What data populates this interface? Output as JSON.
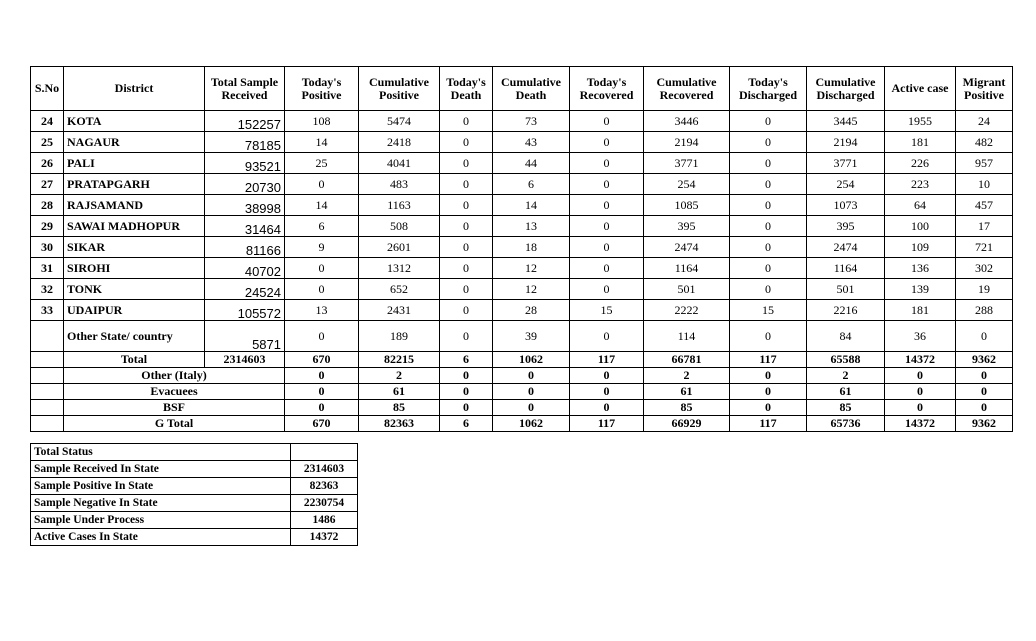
{
  "headers": [
    "S.No",
    "District",
    "Total Sample Received",
    "Today's Positive",
    "Cumulative Positive",
    "Today's Death",
    "Cumulative Death",
    "Today's Recovered",
    "Cumulative Recovered",
    "Today's Discharged",
    "Cumulative Discharged",
    "Active case",
    "Migrant Positive"
  ],
  "rows": [
    [
      "24",
      "KOTA",
      "152257",
      "108",
      "5474",
      "0",
      "73",
      "0",
      "3446",
      "0",
      "3445",
      "1955",
      "24"
    ],
    [
      "25",
      "NAGAUR",
      "78185",
      "14",
      "2418",
      "0",
      "43",
      "0",
      "2194",
      "0",
      "2194",
      "181",
      "482"
    ],
    [
      "26",
      "PALI",
      "93521",
      "25",
      "4041",
      "0",
      "44",
      "0",
      "3771",
      "0",
      "3771",
      "226",
      "957"
    ],
    [
      "27",
      "PRATAPGARH",
      "20730",
      "0",
      "483",
      "0",
      "6",
      "0",
      "254",
      "0",
      "254",
      "223",
      "10"
    ],
    [
      "28",
      "RAJSAMAND",
      "38998",
      "14",
      "1163",
      "0",
      "14",
      "0",
      "1085",
      "0",
      "1073",
      "64",
      "457"
    ],
    [
      "29",
      "SAWAI MADHOPUR",
      "31464",
      "6",
      "508",
      "0",
      "13",
      "0",
      "395",
      "0",
      "395",
      "100",
      "17"
    ],
    [
      "30",
      "SIKAR",
      "81166",
      "9",
      "2601",
      "0",
      "18",
      "0",
      "2474",
      "0",
      "2474",
      "109",
      "721"
    ],
    [
      "31",
      "SIROHI",
      "40702",
      "0",
      "1312",
      "0",
      "12",
      "0",
      "1164",
      "0",
      "1164",
      "136",
      "302"
    ],
    [
      "32",
      "TONK",
      "24524",
      "0",
      "652",
      "0",
      "12",
      "0",
      "501",
      "0",
      "501",
      "139",
      "19"
    ],
    [
      "33",
      "UDAIPUR",
      "105572",
      "13",
      "2431",
      "0",
      "28",
      "15",
      "2222",
      "15",
      "2216",
      "181",
      "288"
    ],
    [
      "",
      "Other State/ country",
      "5871",
      "0",
      "189",
      "0",
      "39",
      "0",
      "114",
      "0",
      "84",
      "36",
      "0"
    ]
  ],
  "total": [
    "Total",
    "2314603",
    "670",
    "82215",
    "6",
    "1062",
    "117",
    "66781",
    "117",
    "65588",
    "14372",
    "9362"
  ],
  "extra_rows": [
    [
      "Other (Italy)",
      "0",
      "2",
      "0",
      "0",
      "0",
      "2",
      "0",
      "2",
      "0",
      "0"
    ],
    [
      "Evacuees",
      "0",
      "61",
      "0",
      "0",
      "0",
      "61",
      "0",
      "61",
      "0",
      "0"
    ],
    [
      "BSF",
      "0",
      "85",
      "0",
      "0",
      "0",
      "85",
      "0",
      "85",
      "0",
      "0"
    ],
    [
      "G Total",
      "670",
      "82363",
      "6",
      "1062",
      "117",
      "66929",
      "117",
      "65736",
      "14372",
      "9362"
    ]
  ],
  "status": {
    "title": "Total Status",
    "items": [
      [
        "Sample Received In State",
        "2314603"
      ],
      [
        "Sample Positive In State",
        "82363"
      ],
      [
        "Sample Negative In State",
        "2230754"
      ],
      [
        "Sample Under Process",
        "1486"
      ],
      [
        "Active Cases In State",
        "14372"
      ]
    ]
  }
}
